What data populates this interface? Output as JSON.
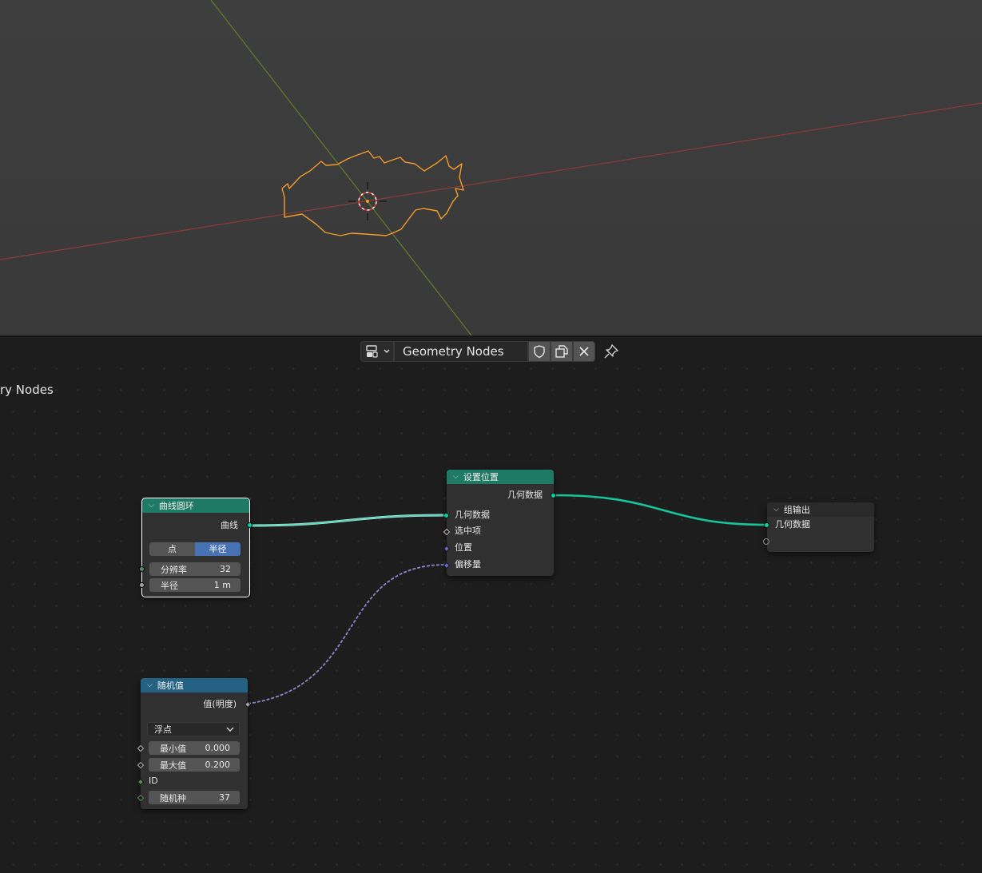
{
  "header": {
    "node_group_name": "Geometry Nodes",
    "editor_label": "ry Nodes",
    "icons": [
      "node-tree-type-icon",
      "chevron-down-icon",
      "fake-user-shield-icon",
      "duplicate-icon",
      "close-icon",
      "pin-icon"
    ]
  },
  "nodes": {
    "curve_circle": {
      "title": "曲线圆环",
      "output": "曲线",
      "mode_options": [
        "点",
        "半径"
      ],
      "mode_selected": "半径",
      "resolution_label": "分辨率",
      "resolution_value": "32",
      "radius_label": "半径",
      "radius_value": "1 m"
    },
    "set_position": {
      "title": "设置位置",
      "output": "几何数据",
      "inputs": [
        "几何数据",
        "选中项",
        "位置",
        "偏移量"
      ]
    },
    "group_output": {
      "title": "组输出",
      "input": "几何数据"
    },
    "random_value": {
      "title": "随机值",
      "output": "值(明度)",
      "type_selected": "浮点",
      "min_label": "最小值",
      "min_value": "0.000",
      "max_label": "最大值",
      "max_value": "0.200",
      "id_label": "ID",
      "seed_label": "随机种",
      "seed_value": "37"
    }
  },
  "colors": {
    "geometry_socket": "#00d6a3",
    "vector_socket": "#6363c7",
    "geometry_header": "#1e7a64",
    "utility_header": "#246283",
    "selection_curve": "#f39c2b",
    "x_axis": "#a03a3a",
    "y_axis": "#6a8a2a"
  }
}
